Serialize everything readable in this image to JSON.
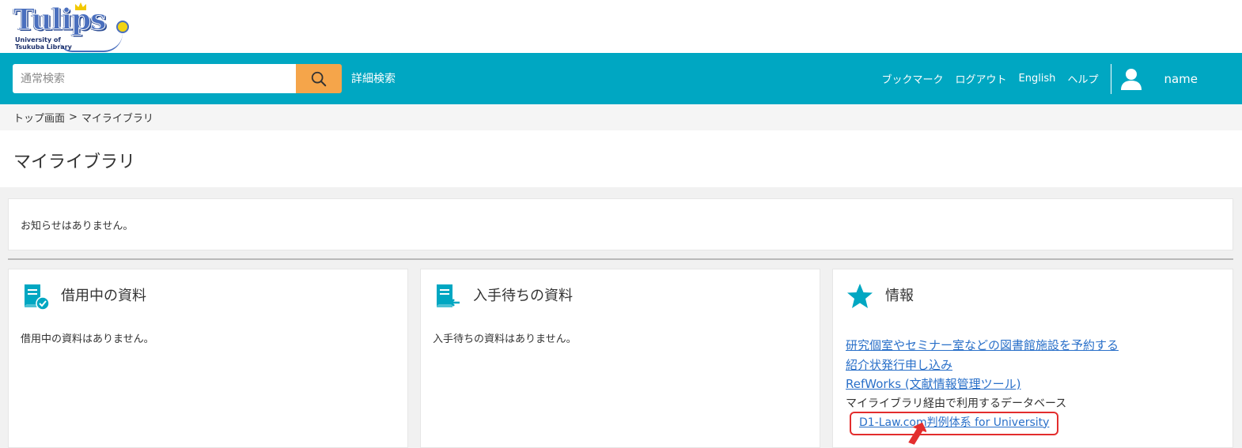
{
  "logo": {
    "text": "Tulips",
    "subtitle_line1": "University of",
    "subtitle_line2": "Tsukuba Library"
  },
  "search": {
    "placeholder": "通常検索",
    "advanced_label": "詳細検索"
  },
  "nav": {
    "bookmark": "ブックマーク",
    "logout": "ログアウト",
    "english": "English",
    "help": "ヘルプ",
    "user_name": "name"
  },
  "breadcrumb": {
    "home": "トップ画面",
    "separator": ">",
    "current": "マイライブラリ"
  },
  "page_title": "マイライブラリ",
  "notice": "お知らせはありません。",
  "cards": {
    "borrowed": {
      "title": "借用中の資料",
      "body": "借用中の資料はありません。"
    },
    "waiting": {
      "title": "入手待ちの資料",
      "body": "入手待ちの資料はありません。"
    },
    "info": {
      "title": "情報",
      "links": [
        "研究個室やセミナー室などの図書館施設を予約する",
        "紹介状発行申し込み",
        "RefWorks (文献情報管理ツール)"
      ],
      "database_label": "マイライブラリ経由で利用するデータベース",
      "database_link": "D1-Law.com判例体系 for University"
    }
  },
  "colors": {
    "nav_bar": "#00a7c2",
    "search_button": "#f5a54a",
    "link": "#2a70c9",
    "highlight": "#e32d2d",
    "icon_teal": "#00a7c2"
  }
}
